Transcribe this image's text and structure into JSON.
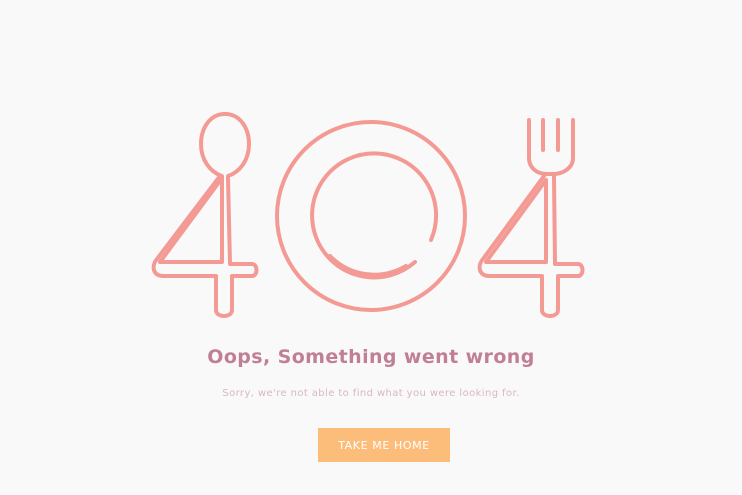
{
  "illustration": {
    "icons": [
      "spoon-four-icon",
      "plate-zero-icon",
      "fork-four-icon"
    ],
    "stroke_color": "#f39a94"
  },
  "message": {
    "title": "Oops, Something went wrong",
    "subtitle": "Sorry, we're not able to find what you were looking for."
  },
  "action": {
    "home_label": "TAKE ME HOME",
    "button_color": "#fdbd7a"
  },
  "colors": {
    "background": "#faf9fa",
    "title": "#c07f92",
    "subtitle": "#d8b7c3"
  }
}
